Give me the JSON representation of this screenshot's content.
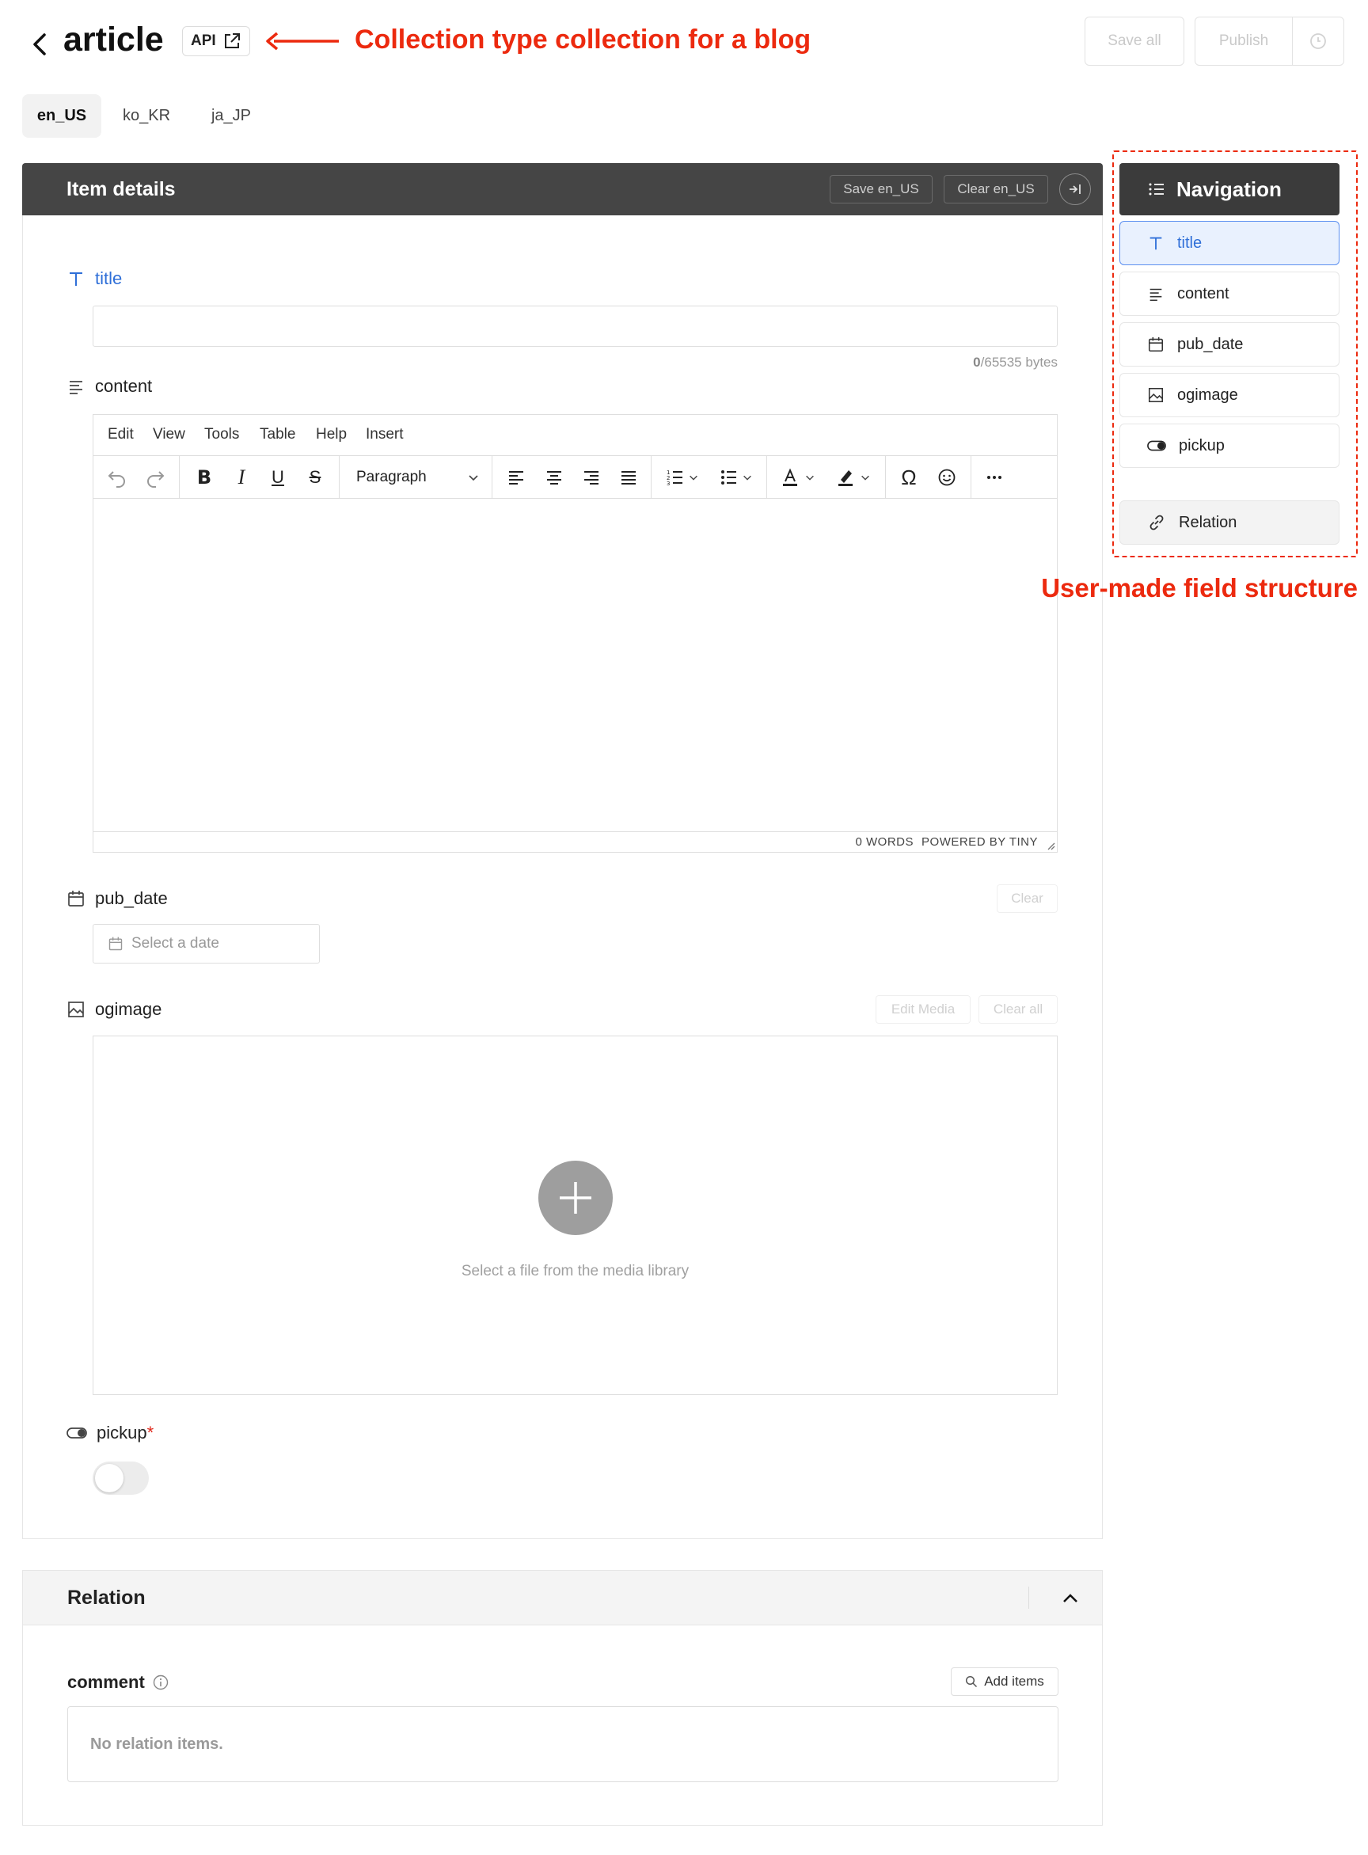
{
  "header": {
    "title": "article",
    "api_label": "API",
    "annotation": "Collection type collection for a blog",
    "save_all_label": "Save all",
    "publish_label": "Publish"
  },
  "locales": [
    {
      "label": "en_US",
      "active": true
    },
    {
      "label": "ko_KR",
      "active": false
    },
    {
      "label": "ja_JP",
      "active": false
    }
  ],
  "item_details": {
    "title": "Item details",
    "save_locale_label": "Save en_US",
    "clear_locale_label": "Clear en_US"
  },
  "fields": {
    "title": {
      "label": "title",
      "value": "",
      "byte_count": "0",
      "byte_limit": "/65535 bytes"
    },
    "content": {
      "label": "content",
      "menu": [
        "Edit",
        "View",
        "Tools",
        "Table",
        "Help",
        "Insert"
      ],
      "block_format": "Paragraph",
      "word_count": "0 WORDS",
      "powered_by": "POWERED BY TINY"
    },
    "pub_date": {
      "label": "pub_date",
      "placeholder": "Select a date",
      "clear_label": "Clear"
    },
    "ogimage": {
      "label": "ogimage",
      "edit_media_label": "Edit Media",
      "clear_all_label": "Clear all",
      "dropzone_text": "Select a file from the media library"
    },
    "pickup": {
      "label": "pickup",
      "required_mark": "*",
      "value": false
    }
  },
  "relation": {
    "title": "Relation",
    "comment_label": "comment",
    "add_items_label": "Add items",
    "empty_text": "No relation items."
  },
  "navigation": {
    "title": "Navigation",
    "items": [
      {
        "label": "title",
        "icon": "text-type-icon",
        "active": true
      },
      {
        "label": "content",
        "icon": "paragraph-icon",
        "active": false
      },
      {
        "label": "pub_date",
        "icon": "calendar-icon",
        "active": false
      },
      {
        "label": "ogimage",
        "icon": "image-icon",
        "active": false
      },
      {
        "label": "pickup",
        "icon": "toggle-icon",
        "active": false
      },
      {
        "label": "Relation",
        "icon": "link-icon",
        "active": false
      }
    ],
    "annotation": "User-made field structure"
  },
  "colors": {
    "annotation_red": "#ec2a0f",
    "accent_blue": "#2f6fd8",
    "dark_bar": "#454545"
  }
}
